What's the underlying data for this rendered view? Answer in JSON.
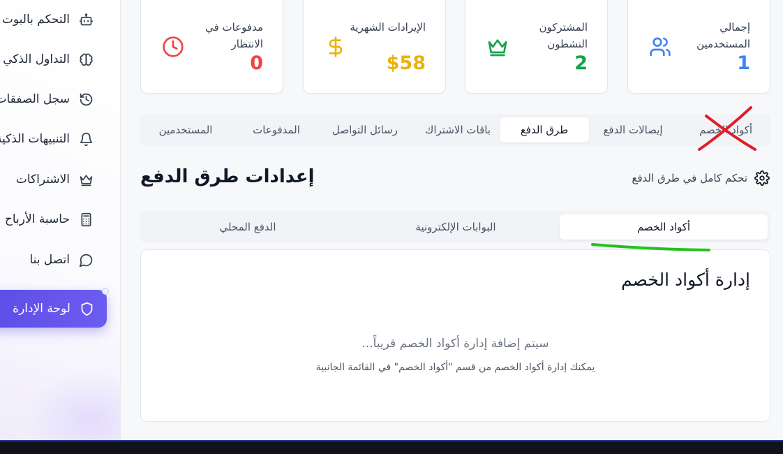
{
  "sidebar": {
    "items": [
      {
        "label": "التحكم بالبوت",
        "icon": "robot-icon"
      },
      {
        "label": "التداول الذكي",
        "icon": "brain-icon"
      },
      {
        "label": "سجل الصفقات",
        "icon": "history-icon"
      },
      {
        "label": "التنبيهات الذكية",
        "icon": "bell-icon"
      },
      {
        "label": "الاشتراكات",
        "icon": "crown-icon"
      },
      {
        "label": "حاسبة الأرباح",
        "icon": "calculator-icon"
      },
      {
        "label": "اتصل بنا",
        "icon": "chat-icon"
      }
    ],
    "active": {
      "label": "لوحة الإدارة",
      "icon": "shield-icon"
    }
  },
  "stats": [
    {
      "label": "إجمالي المستخدمين",
      "value": "1",
      "icon": "users-icon",
      "color": "#3b82f6"
    },
    {
      "label": "المشتركون النشطون",
      "value": "2",
      "icon": "crown-icon",
      "color": "#16a34a"
    },
    {
      "label": "الإيرادات الشهرية",
      "value": "$58",
      "icon": "dollar-icon",
      "color": "#eab308"
    },
    {
      "label": "مدفوعات في الانتظار",
      "value": "0",
      "icon": "clock-icon",
      "color": "#ef4444"
    }
  ],
  "main_tabs": [
    "أكواد الخصم",
    "إيصالات الدفع",
    "طرق الدفع",
    "باقات الاشتراك",
    "رسائل التواصل",
    "المدفوعات",
    "المستخدمين"
  ],
  "main_tabs_active": "طرق الدفع",
  "section": {
    "title": "إعدادات طرق الدفع",
    "subtitle": "تحكم كامل في طرق الدفع"
  },
  "sub_tabs": [
    "أكواد الخصم",
    "البوابات الإلكترونية",
    "الدفع المحلي"
  ],
  "sub_tabs_active": "أكواد الخصم",
  "content": {
    "title": "إدارة أكواد الخصم",
    "message": "سيتم إضافة إدارة أكواد الخصم قريباً...",
    "hint": "يمكنك إدارة أكواد الخصم من قسم \"أكواد الخصم\" في القائمة الجانبية"
  },
  "colors": {
    "accent": "#5b4de6",
    "annotation_cross": "#e11d2a",
    "annotation_underline": "#22c21d"
  }
}
